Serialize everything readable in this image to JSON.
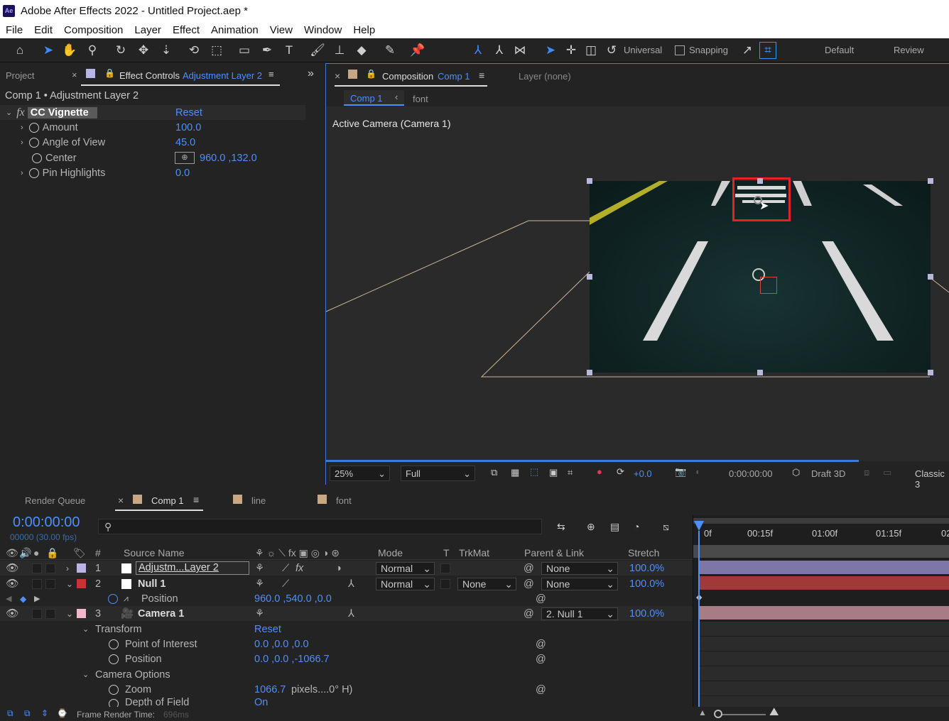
{
  "window": {
    "app_icon": "Ae",
    "title": "Adobe After Effects 2022 - Untitled Project.aep *"
  },
  "menu": [
    "File",
    "Edit",
    "Composition",
    "Layer",
    "Effect",
    "Animation",
    "View",
    "Window",
    "Help"
  ],
  "toolbar": {
    "axis_mode": "Universal",
    "snapping": "Snapping",
    "workspaces": [
      "Default",
      "Review"
    ]
  },
  "left_panel": {
    "tab_project": "Project",
    "tab_effect_controls": "Effect Controls",
    "tab_effect_controls_layer": "Adjustment Layer 2",
    "breadcrumb": "Comp 1 • Adjustment Layer 2",
    "effect": {
      "name": "CC Vignette",
      "reset": "Reset"
    },
    "properties": [
      {
        "name": "Amount",
        "value": "100.0"
      },
      {
        "name": "Angle of View",
        "value": "45.0"
      },
      {
        "name": "Center",
        "value": "960.0 ,132.0"
      },
      {
        "name": "Pin Highlights",
        "value": "0.0"
      }
    ]
  },
  "comp_panel": {
    "tab_label": "Composition",
    "tab_comp": "Comp 1",
    "layer_tab": "Layer (none)",
    "nav_current": "Comp 1",
    "nav_other": "font",
    "camera_label": "Active Camera (Camera 1)",
    "zoom": "25%",
    "resolution": "Full",
    "exposure": "+0.0",
    "timecode": "0:00:00:00",
    "renderer": "Draft 3D",
    "view_mode": "Classic 3"
  },
  "timeline": {
    "tabs": [
      "Render Queue",
      "Comp 1",
      "line",
      "font"
    ],
    "timecode": "0:00:00:00",
    "frames": "00000 (30.00 fps)",
    "search_placeholder": "",
    "columns": {
      "num": "#",
      "source": "Source Name",
      "mode": "Mode",
      "t": "T",
      "trkmat": "TrkMat",
      "parent": "Parent & Link",
      "stretch": "Stretch"
    },
    "ruler": [
      "0f",
      "00:15f",
      "01:00f",
      "01:15f",
      "02"
    ],
    "layers": [
      {
        "num": "1",
        "name": "Adjustm...Layer 2",
        "mode": "Normal",
        "parent": "None",
        "stretch": "100.0%",
        "label_color": "#b9b4e6"
      },
      {
        "num": "2",
        "name": "Null 1",
        "mode": "Normal",
        "trkmat": "None",
        "parent": "None",
        "stretch": "100.0%",
        "label_color": "#c83232"
      },
      {
        "num": "3",
        "name": "Camera 1",
        "parent": "2. Null 1",
        "stretch": "100.0%",
        "label_color": "#f2b8c6"
      }
    ],
    "null_position": {
      "name": "Position",
      "value": "960.0 ,540.0 ,0.0"
    },
    "camera_props": {
      "transform": "Transform",
      "transform_reset": "Reset",
      "poi_name": "Point of Interest",
      "poi_value": "0.0 ,0.0 ,0.0",
      "pos_name": "Position",
      "pos_value": "0.0 ,0.0 ,-1066.7",
      "options": "Camera Options",
      "zoom_name": "Zoom",
      "zoom_value": "1066.7",
      "zoom_unit": "pixels....0° H)",
      "dof_name": "Depth of Field",
      "dof_value": "On"
    },
    "footer": {
      "label": "Frame Render Time:",
      "value": "696ms"
    }
  },
  "colors": {
    "accent": "#4e8ffd",
    "highlight_box": "#e0232b",
    "bar_adjustment": "#7d77a8",
    "bar_null": "#a33838",
    "bar_camera": "#a87c86"
  }
}
